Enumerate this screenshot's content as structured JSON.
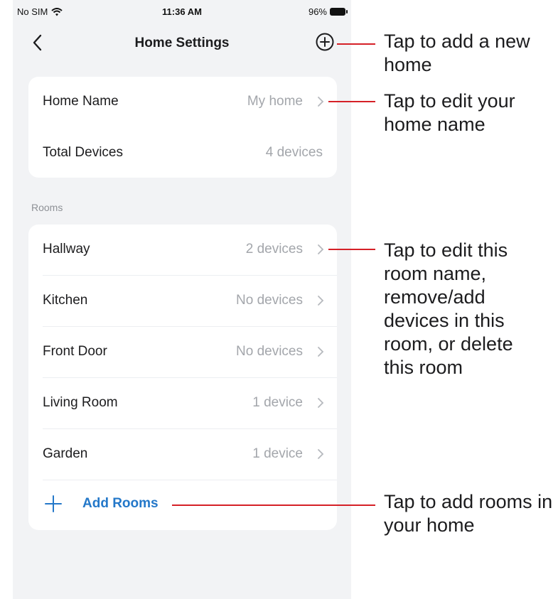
{
  "status_bar": {
    "carrier": "No SIM",
    "time": "11:36 AM",
    "battery": "96%"
  },
  "nav": {
    "title": "Home Settings",
    "back_icon": "chevron-left-icon",
    "add_icon": "plus-circle-icon"
  },
  "home_card": {
    "rows": [
      {
        "label": "Home Name",
        "value": "My home"
      },
      {
        "label": "Total Devices",
        "value": "4 devices"
      }
    ]
  },
  "rooms_section": {
    "header": "Rooms",
    "rooms": [
      {
        "label": "Hallway",
        "value": "2 devices"
      },
      {
        "label": "Kitchen",
        "value": "No devices"
      },
      {
        "label": "Front Door",
        "value": "No devices"
      },
      {
        "label": "Living Room",
        "value": "1 device"
      },
      {
        "label": "Garden",
        "value": "1 device"
      }
    ],
    "add_rooms_label": "Add Rooms"
  },
  "annotations": {
    "add_home": "Tap to add a new home",
    "edit_home_name": "Tap to edit your home name",
    "edit_room": "Tap to edit this room name, remove/add devices in this room, or delete this room",
    "add_rooms": "Tap to add rooms in your home"
  },
  "colors": {
    "accent": "#2478c9",
    "callout": "#d52027",
    "background": "#f2f3f5",
    "secondary_text": "#a3a6ab"
  }
}
